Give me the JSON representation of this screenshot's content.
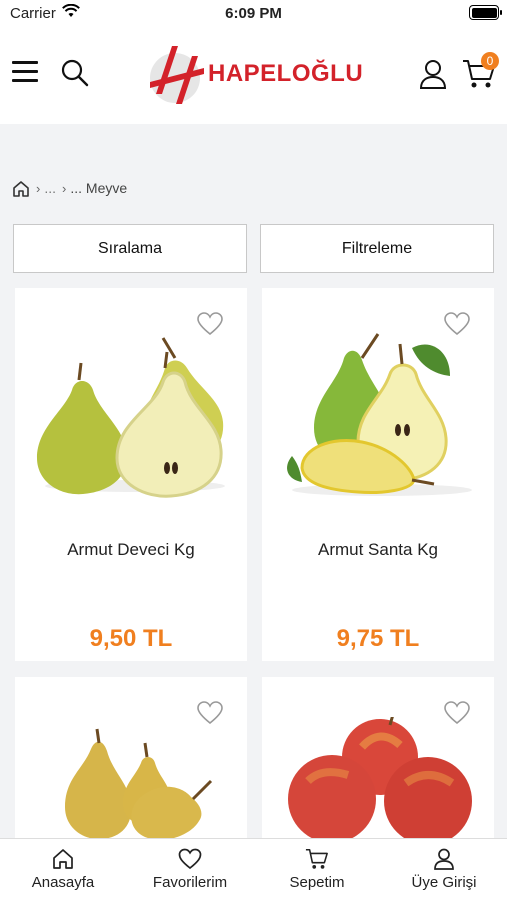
{
  "status_bar": {
    "carrier": "Carrier",
    "time": "6:09 PM"
  },
  "header": {
    "brand": "HAPELOĞLU",
    "cart_count": "0",
    "icons": [
      "menu-icon",
      "search-icon",
      "user-icon",
      "cart-icon"
    ]
  },
  "breadcrumb": {
    "ellipsis_1": "...",
    "ellipsis_2": "...",
    "current": "... Meyve"
  },
  "toolbar": {
    "sort_label": "Sıralama",
    "filter_label": "Filtreleme"
  },
  "products": [
    {
      "name": "Armut Deveci Kg",
      "price": "9,50 TL"
    },
    {
      "name": "Armut Santa Kg",
      "price": "9,75 TL"
    },
    {
      "name": "",
      "price": ""
    },
    {
      "name": "",
      "price": ""
    }
  ],
  "tabbar": [
    {
      "label": "Anasayfa",
      "icon": "home-icon"
    },
    {
      "label": "Favorilerim",
      "icon": "heart-icon"
    },
    {
      "label": "Sepetim",
      "icon": "cart-icon"
    },
    {
      "label": "Üye Girişi",
      "icon": "user-icon"
    }
  ],
  "colors": {
    "accent": "#f07f1f",
    "brand": "#d3222a"
  }
}
